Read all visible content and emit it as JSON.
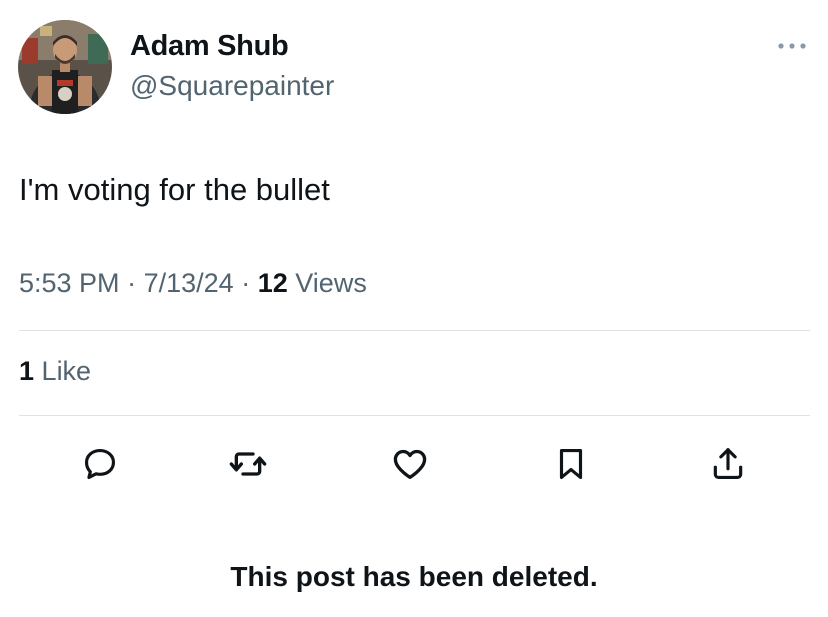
{
  "author": {
    "display_name": "Adam Shub",
    "handle": "@Squarepainter"
  },
  "post": {
    "text": "I'm voting for the bullet",
    "time": "5:53 PM",
    "date": "7/13/24",
    "separator": "·",
    "views_count": "12",
    "views_label": "Views",
    "likes_count": "1",
    "likes_label": "Like"
  },
  "icons": {
    "more": "more-horizontal-icon",
    "reply": "reply-icon",
    "repost": "repost-icon",
    "like": "heart-icon",
    "bookmark": "bookmark-icon",
    "share": "share-icon"
  },
  "colors": {
    "text_primary": "#0f1419",
    "text_secondary": "#536471",
    "divider": "#dfe3e6"
  },
  "notice": "This post has been deleted."
}
